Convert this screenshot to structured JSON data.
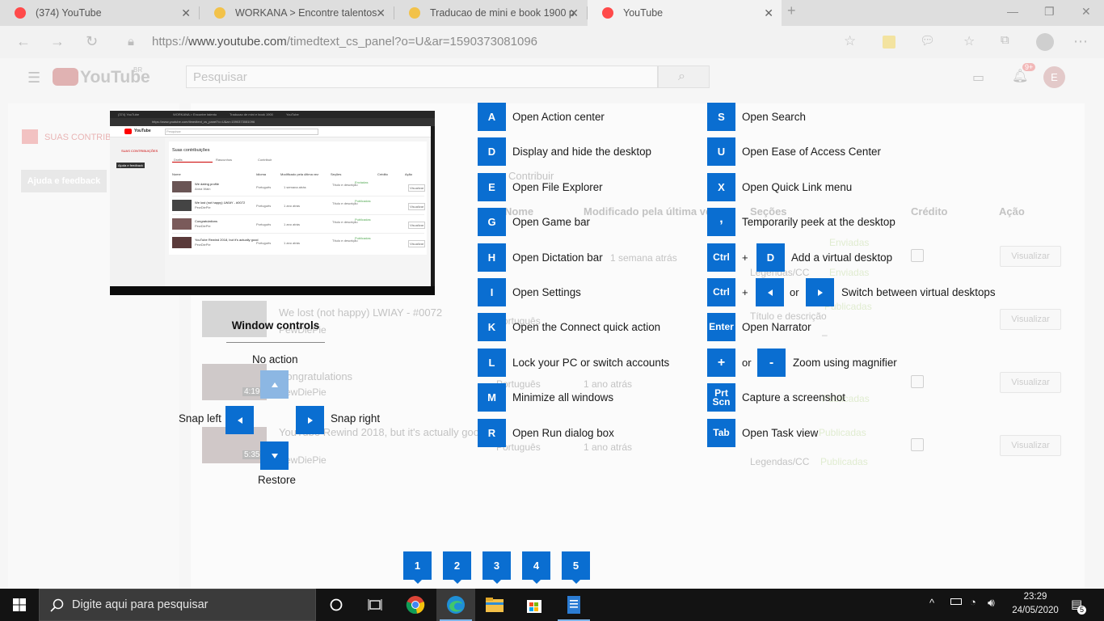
{
  "browser": {
    "tabs": [
      {
        "title": "(374) YouTube",
        "color": "#ff0000"
      },
      {
        "title": "WORKANA > Encontre talentos",
        "color": "#f2b01e"
      },
      {
        "title": "Traducao de mini e book 1900 p",
        "color": "#f2b01e"
      },
      {
        "title": "YouTube",
        "color": "#ff0000"
      }
    ],
    "url_scheme": "https://",
    "url_host": "www.youtube.com",
    "url_path": "/timedtext_cs_panel?o=U&ar=1590373081096"
  },
  "youtube": {
    "search_placeholder": "Pesquisar",
    "logo_text": "YouTube",
    "logo_region": "BR",
    "notifications": "9+",
    "account_initial": "E",
    "sidebar_title": "SUAS CONTRIBUIÇÕES",
    "help_button": "Ajuda e feedback",
    "tab_contribute": "Contribuir",
    "columns": {
      "name": "Nome",
      "modified": "Modificado pela última vez",
      "sections": "Seções",
      "credit": "Crédito",
      "action": "Ação"
    },
    "rows": [
      {
        "title": "",
        "channel": "",
        "language": "",
        "modified": "1 semana atrás",
        "sec1": "Título e descrição",
        "sec2": "Legendas/CC",
        "status": "Enviadas",
        "status2": "Enviadas",
        "action": "Visualizar"
      },
      {
        "title": "We lost (not happy) LWIAY - #0072",
        "channel": "PewDiePie",
        "language": "Português",
        "modified": "1 ano atrás",
        "sec1": "Título e descrição",
        "sec2": "Legendas/CC",
        "status": "Publicadas",
        "status2": "–",
        "action": "Visualizar"
      },
      {
        "title": "Congratulations",
        "channel": "PewDiePie",
        "language": "Português",
        "modified": "1 ano atrás",
        "sec1": "Título e descrição",
        "sec2": "Legendas/CC",
        "status": "Publicadas",
        "status2": "Publicadas",
        "action": "Visualizar",
        "duration": "4:19"
      },
      {
        "title": "YouTube Rewind 2018, but it's actually good",
        "channel": "PewDiePie",
        "language": "Português",
        "modified": "1 ano atrás",
        "sec1": "Título e descrição",
        "sec2": "Legendas/CC",
        "status": "Publicadas",
        "status2": "Publicadas",
        "action": "Visualizar",
        "duration": "5:35"
      }
    ]
  },
  "preview": {
    "tabs": [
      "(374) YouTube",
      "WORKANA > Encontre talento",
      "Traducao de mini e book 1900",
      "YouTube"
    ],
    "url": "https://www.youtube.com/timedtext_cs_panel?o=U&ar=1590373081096",
    "search": "Pesquisar",
    "sidebar_title": "SUAS CONTRIBUIÇÕES",
    "help": "Ajuda e feedback",
    "heading": "Suas contribuições",
    "tabs_row": [
      "Drafts",
      "Rascunhos",
      "Contribuir"
    ],
    "cols": [
      "Nome",
      "Idioma",
      "Modificado pela última vez",
      "Seções",
      "Crédito",
      "Ação"
    ],
    "rows": [
      {
        "title": "We dating profile",
        "channel": "Anna Wain",
        "lang": "Português",
        "mod": "1 semana atrás",
        "sec": "Título e descrição",
        "status": "Enviadas",
        "action": "Visualizar"
      },
      {
        "title": "We lost (not happy) LWIAY - #0072",
        "channel": "PewDiePie",
        "lang": "Português",
        "mod": "1 ano atrás",
        "sec": "Título e descrição",
        "status": "Publicadas",
        "action": "Visualizar"
      },
      {
        "title": "Congratulations",
        "channel": "PewDiePie",
        "lang": "Português",
        "mod": "1 ano atrás",
        "sec": "Título e descrição",
        "status": "Publicadas",
        "action": "Visualizar"
      },
      {
        "title": "YouTube Rewind 2018, but it's actually good",
        "channel": "PewDiePie",
        "lang": "Português",
        "mod": "1 ano atrás",
        "sec": "Título e descrição",
        "status": "Publicadas",
        "action": "Visualizar"
      }
    ]
  },
  "window_controls": {
    "title": "Window controls",
    "up": "No action",
    "left": "Snap left",
    "right": "Snap right",
    "down": "Restore"
  },
  "shortcuts_left": [
    {
      "key": "A",
      "label": "Open Action center"
    },
    {
      "key": "D",
      "label": "Display and hide the desktop"
    },
    {
      "key": "E",
      "label": "Open File Explorer"
    },
    {
      "key": "G",
      "label": "Open Game bar"
    },
    {
      "key": "H",
      "label": "Open Dictation bar"
    },
    {
      "key": "I",
      "label": "Open Settings"
    },
    {
      "key": "K",
      "label": "Open the Connect quick action"
    },
    {
      "key": "L",
      "label": "Lock your PC or switch accounts"
    },
    {
      "key": "M",
      "label": "Minimize all windows"
    },
    {
      "key": "R",
      "label": "Open Run dialog box"
    }
  ],
  "shortcuts_right": [
    {
      "key": "S",
      "label": "Open Search"
    },
    {
      "key": "U",
      "label": "Open Ease of Access Center"
    },
    {
      "key": "X",
      "label": "Open Quick Link menu"
    },
    {
      "key": ",",
      "label": "Temporarily peek at the desktop"
    },
    {
      "key": "Ctrl",
      "plus": "+",
      "key2": "D",
      "label": "Add a virtual desktop"
    },
    {
      "key": "Ctrl",
      "plus": "+",
      "or": "or",
      "label": "Switch between virtual desktops"
    },
    {
      "key": "Enter",
      "label": "Open Narrator"
    },
    {
      "key": "+",
      "or": "or",
      "key2": "-",
      "label": "Zoom using magnifier"
    },
    {
      "key": "Prt Scn",
      "label": "Capture a screenshot"
    },
    {
      "key": "Tab",
      "label": "Open Task view"
    }
  ],
  "number_keys": [
    "1",
    "2",
    "3",
    "4",
    "5"
  ],
  "taskbar": {
    "search_placeholder": "Digite aqui para pesquisar",
    "time": "23:29",
    "date": "24/05/2020",
    "notification_count": "5"
  },
  "colors": {
    "accent_blue": "#0a6ed1",
    "youtube_red": "#ff0000",
    "taskbar": "#131313"
  }
}
